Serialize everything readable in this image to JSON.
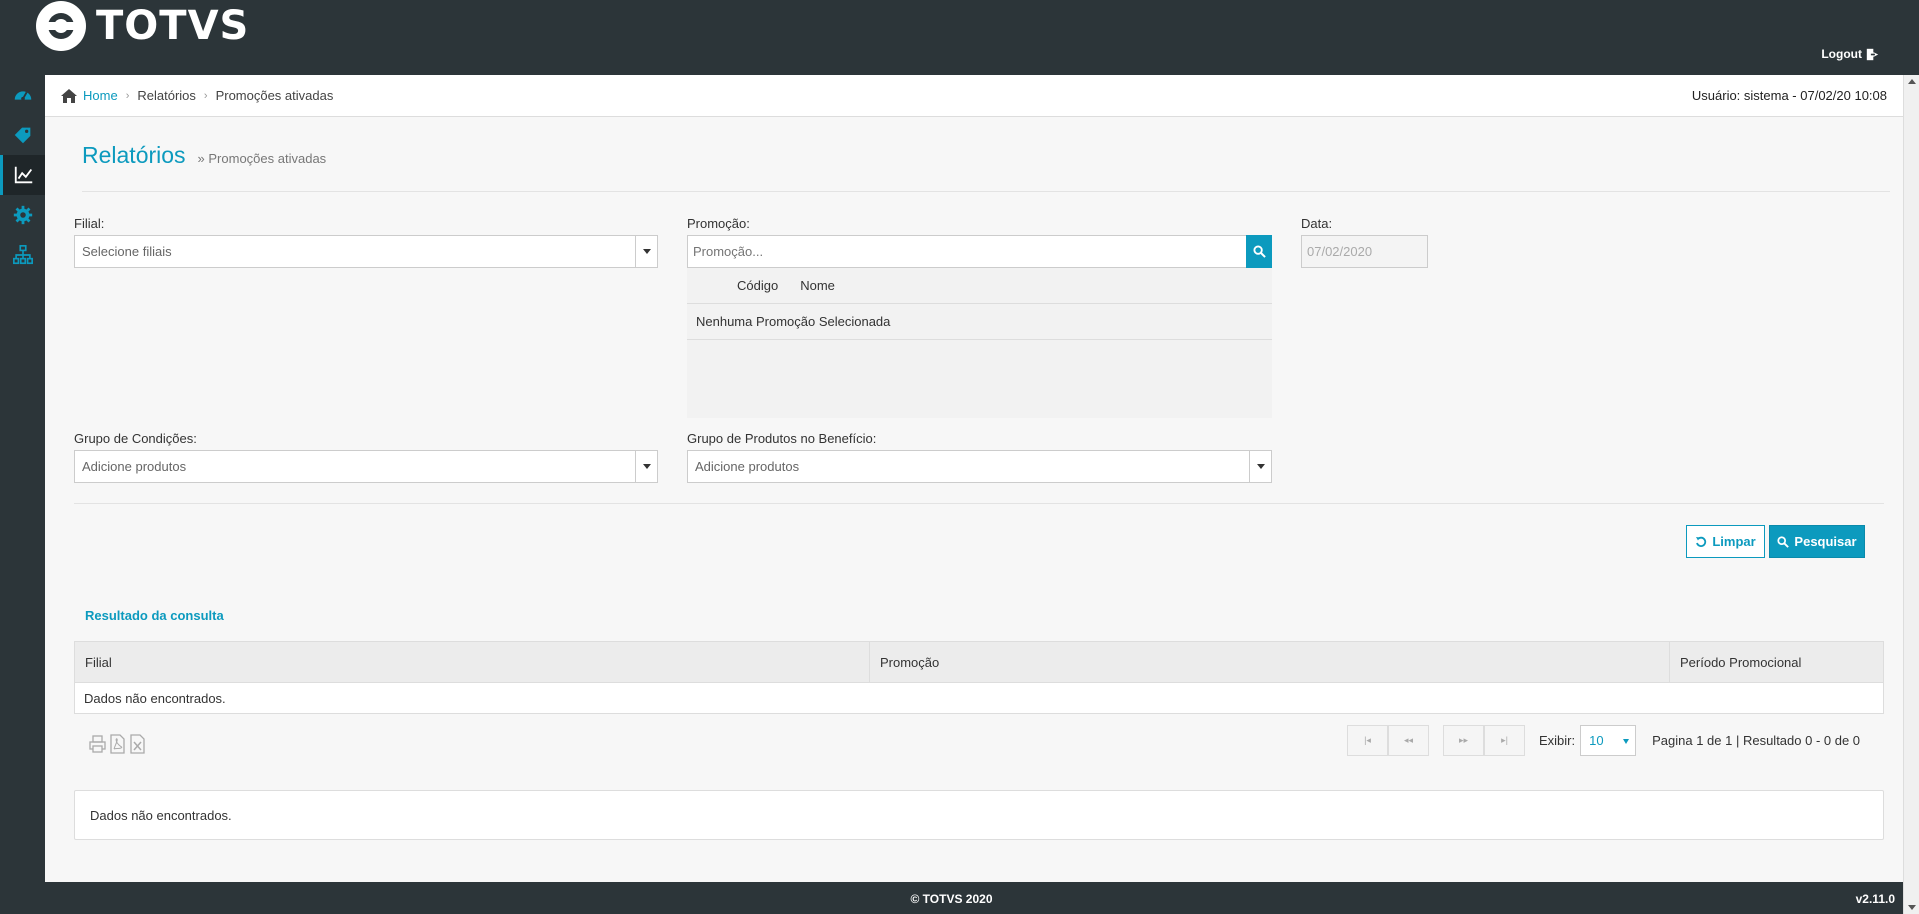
{
  "brand": {
    "name": "TOTVS"
  },
  "header": {
    "logout_label": "Logout"
  },
  "sidebar": {
    "items": [
      {
        "name": "dashboard",
        "icon": "dashboard-icon"
      },
      {
        "name": "promotions",
        "icon": "tags-icon"
      },
      {
        "name": "reports",
        "icon": "line-chart-icon",
        "active": true
      },
      {
        "name": "settings",
        "icon": "gear-icon"
      },
      {
        "name": "structure",
        "icon": "sitemap-icon"
      }
    ]
  },
  "breadcrumb": {
    "home": "Home",
    "items": [
      "Relatórios",
      "Promoções ativadas"
    ],
    "separator": "›"
  },
  "user_info": "Usuário: sistema - 07/02/20 10:08",
  "page": {
    "title": "Relatórios",
    "subtitle": "» Promoções ativadas"
  },
  "filters": {
    "filial": {
      "label": "Filial:",
      "placeholder": "Selecione filiais"
    },
    "promocao": {
      "label": "Promoção:",
      "placeholder": "Promoção...",
      "columns": [
        "Código",
        "Nome"
      ],
      "empty_text": "Nenhuma Promoção Selecionada"
    },
    "data": {
      "label": "Data:",
      "value": "07/02/2020"
    },
    "grupo_condicoes": {
      "label": "Grupo de Condições:",
      "placeholder": "Adicione produtos"
    },
    "grupo_produtos": {
      "label": "Grupo de Produtos no Benefício:",
      "placeholder": "Adicione produtos"
    }
  },
  "actions": {
    "limpar": "Limpar",
    "pesquisar": "Pesquisar"
  },
  "results": {
    "title": "Resultado da consulta",
    "columns": [
      "Filial",
      "Promoção",
      "Período Promocional"
    ],
    "empty_text": "Dados não encontrados.",
    "pager": {
      "first": "|◂",
      "prev": "◂◂",
      "next": "▸▸",
      "last": "▸|",
      "show_label": "Exibir:",
      "page_size": "10",
      "info": "Pagina 1 de 1 | Resultado 0 - 0 de 0"
    },
    "panel_text": "Dados não encontrados."
  },
  "footer": {
    "copyright": "© TOTVS 2020",
    "version": "v2.11.0"
  },
  "colors": {
    "accent": "#0c9abe",
    "header_bg": "#2c3539",
    "content_bg": "#f7f7f7"
  }
}
